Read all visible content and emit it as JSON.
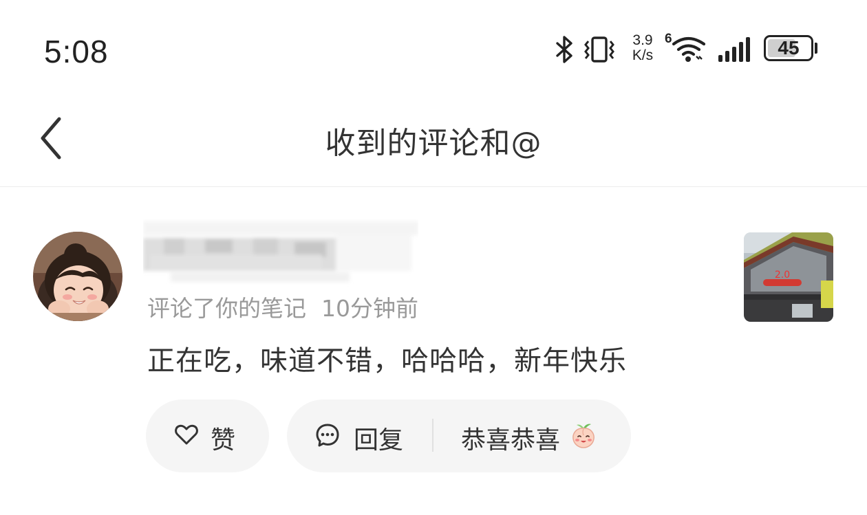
{
  "status_bar": {
    "time": "5:08",
    "network_speed_value": "3.9",
    "network_speed_unit": "K/s",
    "wifi_badge": "6",
    "battery_level": "45"
  },
  "header": {
    "title": "收到的评论和@",
    "back_icon": "chevron-left-icon"
  },
  "comment": {
    "action_text": "评论了你的笔记",
    "time_ago": "10分钟前",
    "text": "正在吃，味道不错，哈哈哈，新年快乐",
    "like_label": "赞",
    "reply_label": "回复",
    "quick_reply_text": "恭喜恭喜",
    "quick_reply_emoji": "peach-face-emoji"
  },
  "colors": {
    "background": "#ffffff",
    "pill_background": "#f5f5f5",
    "primary_text": "#333333",
    "secondary_text": "#999999"
  }
}
